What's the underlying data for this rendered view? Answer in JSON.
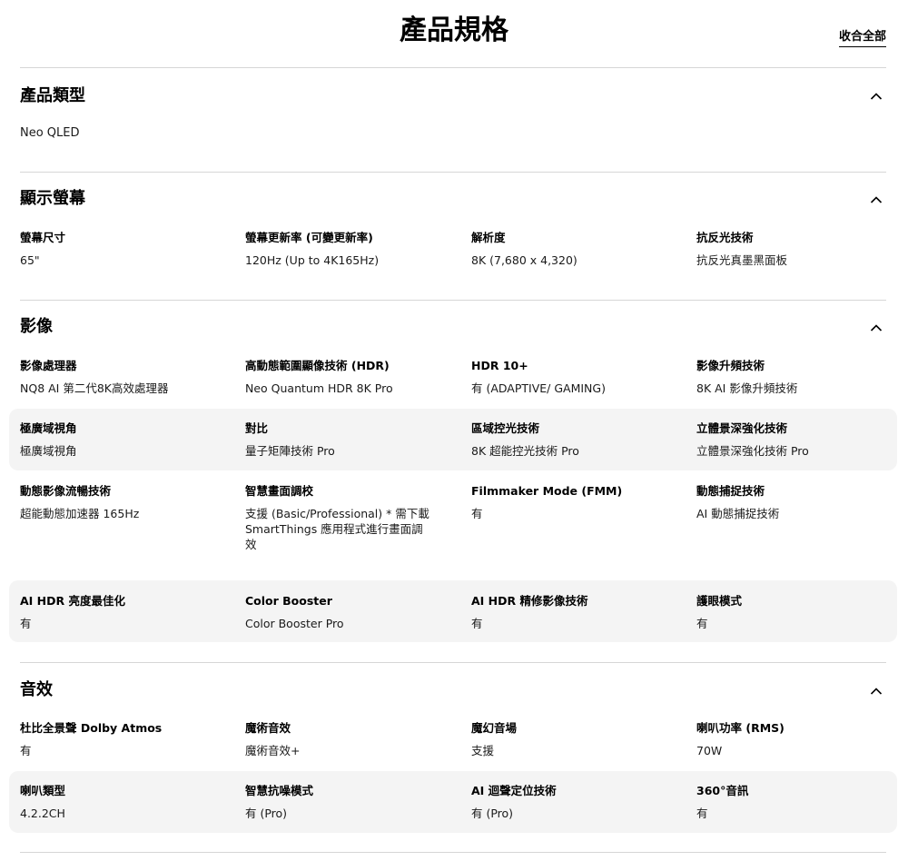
{
  "page": {
    "title": "產品規格",
    "collapse_all": "收合全部"
  },
  "sections": [
    {
      "title": "產品類型",
      "simple_value": "Neo QLED"
    },
    {
      "title": "顯示螢幕",
      "rows": [
        [
          {
            "label": "螢幕尺寸",
            "value": "65\""
          },
          {
            "label": "螢幕更新率 (可變更新率)",
            "value": "120Hz (Up to 4K165Hz)"
          },
          {
            "label": "解析度",
            "value": "8K (7,680 x 4,320)"
          },
          {
            "label": "抗反光技術",
            "value": "抗反光真墨黑面板"
          }
        ]
      ]
    },
    {
      "title": "影像",
      "rows": [
        [
          {
            "label": "影像處理器",
            "value": "NQ8 AI 第二代8K高效處理器"
          },
          {
            "label": "高動態範圍顯像技術 (HDR)",
            "value": "Neo Quantum HDR 8K Pro"
          },
          {
            "label": "HDR 10+",
            "value": "有 (ADAPTIVE/ GAMING)"
          },
          {
            "label": "影像升頻技術",
            "value": "8K AI 影像升頻技術"
          }
        ],
        [
          {
            "label": "極廣域視角",
            "value": "極廣域視角"
          },
          {
            "label": "對比",
            "value": "量子矩陣技術 Pro"
          },
          {
            "label": "區域控光技術",
            "value": "8K 超能控光技術 Pro"
          },
          {
            "label": "立體景深強化技術",
            "value": "立體景深強化技術 Pro"
          }
        ],
        [
          {
            "label": "動態影像流暢技術",
            "value": "超能動態加速器 165Hz"
          },
          {
            "label": "智慧畫面調校",
            "value": "支援 (Basic/Professional) * 需下載 SmartThings 應用程式進行畫面調效"
          },
          {
            "label": "Filmmaker Mode (FMM)",
            "value": "有"
          },
          {
            "label": "動態捕捉技術",
            "value": "AI 動態捕捉技術"
          }
        ],
        [
          {
            "label": "AI HDR 亮度最佳化",
            "value": "有"
          },
          {
            "label": "Color Booster",
            "value": "Color Booster Pro"
          },
          {
            "label": "AI HDR 精修影像技術",
            "value": "有"
          },
          {
            "label": "護眼模式",
            "value": "有"
          }
        ]
      ]
    },
    {
      "title": "音效",
      "rows": [
        [
          {
            "label": "杜比全景聲 Dolby Atmos",
            "value": "有"
          },
          {
            "label": "魔術音效",
            "value": "魔術音效+"
          },
          {
            "label": "魔幻音場",
            "value": "支援"
          },
          {
            "label": "喇叭功率 (RMS)",
            "value": "70W"
          }
        ],
        [
          {
            "label": "喇叭類型",
            "value": "4.2.2CH"
          },
          {
            "label": "智慧抗噪模式",
            "value": "有 (Pro)"
          },
          {
            "label": "AI 迴聲定位技術",
            "value": "有 (Pro)"
          },
          {
            "label": "360°音訊",
            "value": "有"
          }
        ]
      ]
    }
  ]
}
